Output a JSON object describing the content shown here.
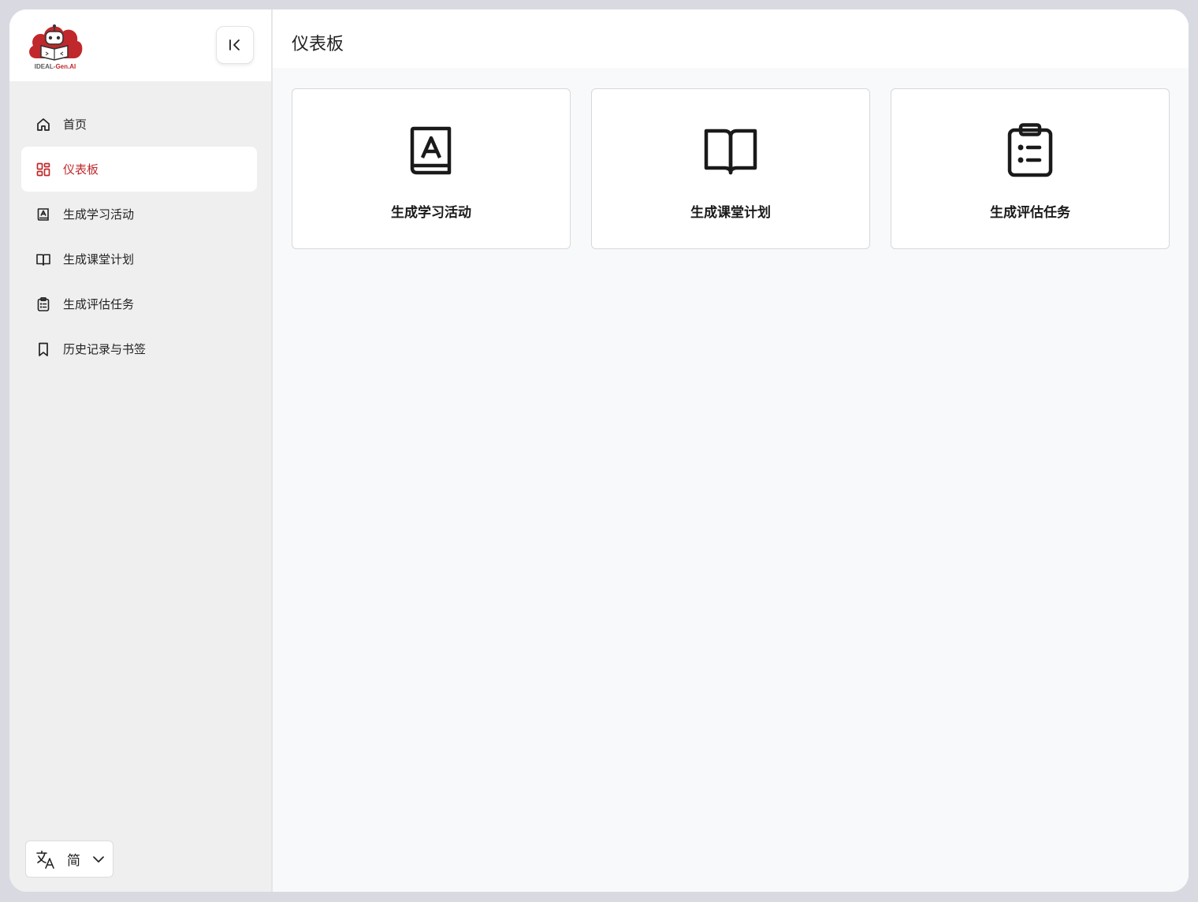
{
  "brand": {
    "name_part1": "IDEAL-",
    "name_part2": "Gen.AI",
    "primary_color": "#c0282b"
  },
  "sidebar": {
    "collapse_icon": "collapse-left-icon",
    "items": [
      {
        "label": "首页",
        "icon": "home-icon",
        "active": false
      },
      {
        "label": "仪表板",
        "icon": "dashboard-icon",
        "active": true
      },
      {
        "label": "生成学习活动",
        "icon": "book-letter-icon",
        "active": false
      },
      {
        "label": "生成课堂计划",
        "icon": "open-book-icon",
        "active": false
      },
      {
        "label": "生成评估任务",
        "icon": "clipboard-icon",
        "active": false
      },
      {
        "label": "历史记录与书签",
        "icon": "bookmark-icon",
        "active": false
      }
    ],
    "language": {
      "icon": "translate-icon",
      "current": "简"
    }
  },
  "main": {
    "title": "仪表板",
    "cards": [
      {
        "label": "生成学习活动",
        "icon": "book-letter-icon"
      },
      {
        "label": "生成课堂计划",
        "icon": "open-book-icon"
      },
      {
        "label": "生成评估任务",
        "icon": "clipboard-icon"
      }
    ]
  }
}
